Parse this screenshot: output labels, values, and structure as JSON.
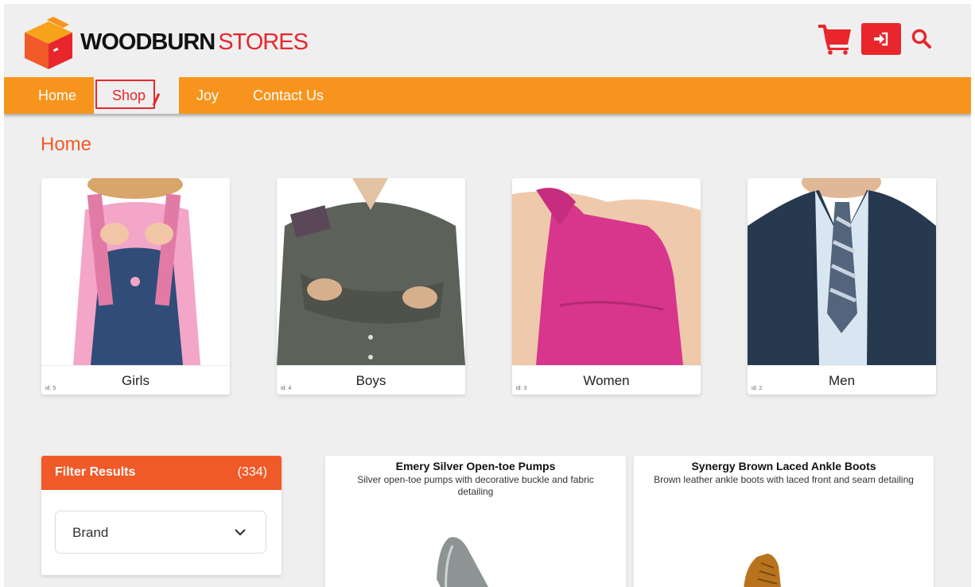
{
  "header": {
    "logo_bold": "WOODBURN",
    "logo_light": "STORES",
    "cart_icon": "cart-icon",
    "login_icon": "sign-in-icon",
    "search_icon": "search-icon"
  },
  "nav": {
    "items": [
      {
        "label": "Home"
      },
      {
        "label": "Shop"
      },
      {
        "label": "Joy"
      },
      {
        "label": "Contact Us"
      }
    ],
    "active": "Shop"
  },
  "page_title": "Home",
  "categories": [
    {
      "label": "Girls",
      "id": "id: 5"
    },
    {
      "label": "Boys",
      "id": "id: 4"
    },
    {
      "label": "Women",
      "id": "id: 3"
    },
    {
      "label": "Men",
      "id": "id: 2"
    }
  ],
  "filter": {
    "title": "Filter Results",
    "count": "(334)",
    "brand_label": "Brand"
  },
  "products": [
    {
      "name": "Emery Silver Open-toe Pumps",
      "description": "Silver open-toe pumps with decorative buckle and fabric detailing"
    },
    {
      "name": "Synergy Brown Laced Ankle Boots",
      "description": "Brown leather ankle boots with laced front and seam detailing"
    }
  ],
  "colors": {
    "brand_red": "#e8262c",
    "nav_orange": "#f7941d",
    "accent_orange": "#f05a28"
  }
}
